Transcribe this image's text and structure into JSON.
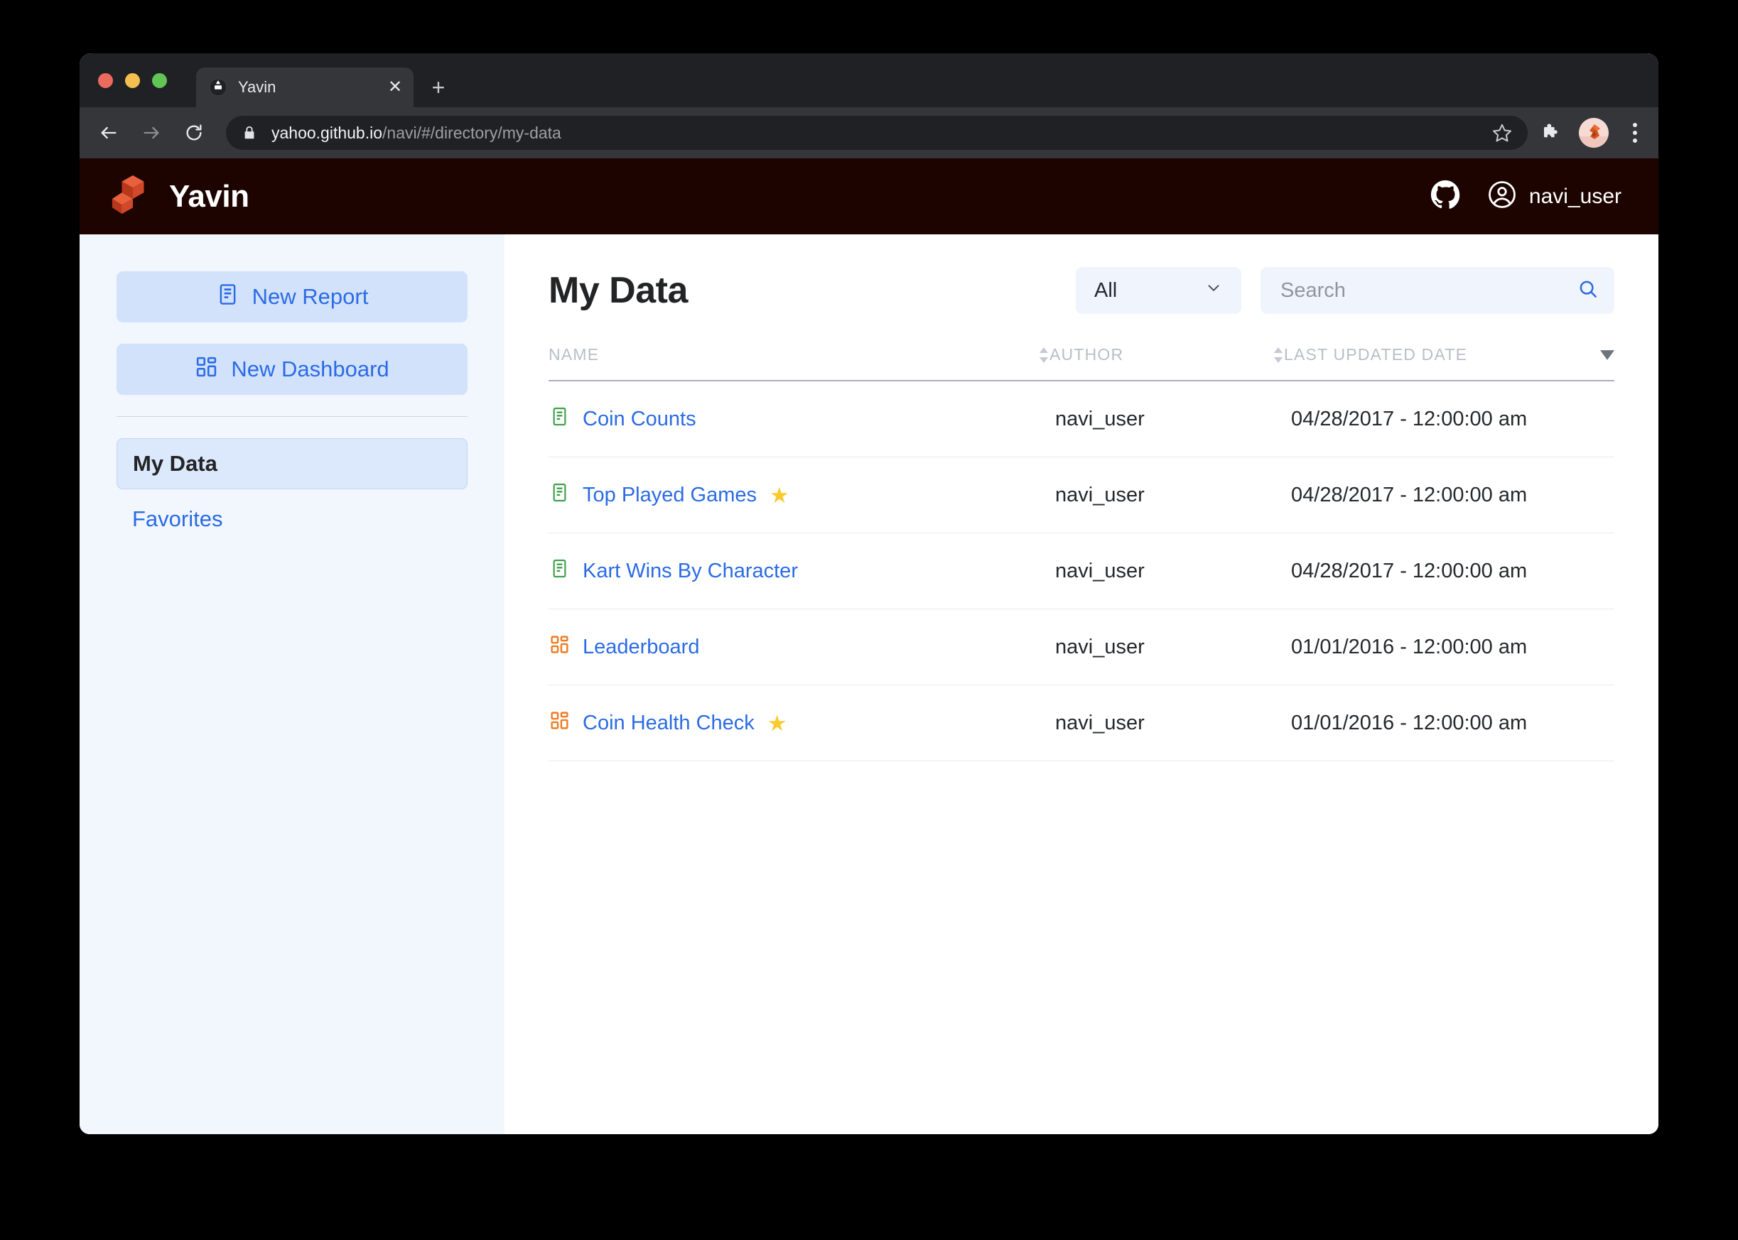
{
  "browser": {
    "tab": {
      "title": "Yavin",
      "favicon_icon": "globe-icon",
      "close_icon": "close-icon"
    },
    "new_tab_icon": "plus-icon",
    "back_icon": "arrow-left-icon",
    "forward_icon": "arrow-right-icon",
    "reload_icon": "reload-icon",
    "lock_icon": "lock-icon",
    "url_host": "yahoo.github.io",
    "url_path": "/navi/#/directory/my-data",
    "bookmark_icon": "star-outline-icon",
    "extensions_icon": "puzzle-piece-icon",
    "profile_icon": "profile-avatar-icon",
    "menu_icon": "three-dot-menu-icon"
  },
  "app_header": {
    "logo_icon": "yavin-cubes-logo-icon",
    "brand": "Yavin",
    "github_icon": "github-icon",
    "user_icon": "user-circle-icon",
    "user_name": "navi_user"
  },
  "sidebar": {
    "new_report": {
      "label": "New Report",
      "icon": "document-report-icon"
    },
    "new_dashboard": {
      "label": "New Dashboard",
      "icon": "dashboard-grid-icon"
    },
    "nav": [
      {
        "label": "My Data",
        "active": true
      },
      {
        "label": "Favorites",
        "active": false
      }
    ]
  },
  "main": {
    "title": "My Data",
    "filter": {
      "value": "All",
      "chevron_icon": "chevron-down-icon"
    },
    "search": {
      "value": "",
      "placeholder": "Search",
      "icon": "search-icon"
    },
    "table": {
      "columns": [
        {
          "label": "NAME",
          "sort_icon": "sort-updown-icon"
        },
        {
          "label": "AUTHOR",
          "sort_icon": "sort-updown-icon"
        },
        {
          "label": "LAST UPDATED DATE",
          "sort_icon": "sort-desc-icon"
        }
      ],
      "rows": [
        {
          "icon": "report-icon",
          "type": "report",
          "name": "Coin Counts",
          "favorite": false,
          "author": "navi_user",
          "updated": "04/28/2017 - 12:00:00 am"
        },
        {
          "icon": "report-icon",
          "type": "report",
          "name": "Top Played Games",
          "favorite": true,
          "author": "navi_user",
          "updated": "04/28/2017 - 12:00:00 am"
        },
        {
          "icon": "report-icon",
          "type": "report",
          "name": "Kart Wins By Character",
          "favorite": false,
          "author": "navi_user",
          "updated": "04/28/2017 - 12:00:00 am"
        },
        {
          "icon": "dashboard-icon",
          "type": "dashboard",
          "name": "Leaderboard",
          "favorite": false,
          "author": "navi_user",
          "updated": "01/01/2016 - 12:00:00 am"
        },
        {
          "icon": "dashboard-icon",
          "type": "dashboard",
          "name": "Coin Health Check",
          "favorite": true,
          "author": "navi_user",
          "updated": "01/01/2016 - 12:00:00 am"
        }
      ],
      "star_glyph": "★"
    }
  },
  "colors": {
    "brand_dark": "#1D0400",
    "accent_blue": "#2B6BE5",
    "report_green": "#3FA04B",
    "dashboard_orange": "#F07B22",
    "star_yellow": "#FBCB2E",
    "sidebar_bg": "#F2F6FD"
  }
}
